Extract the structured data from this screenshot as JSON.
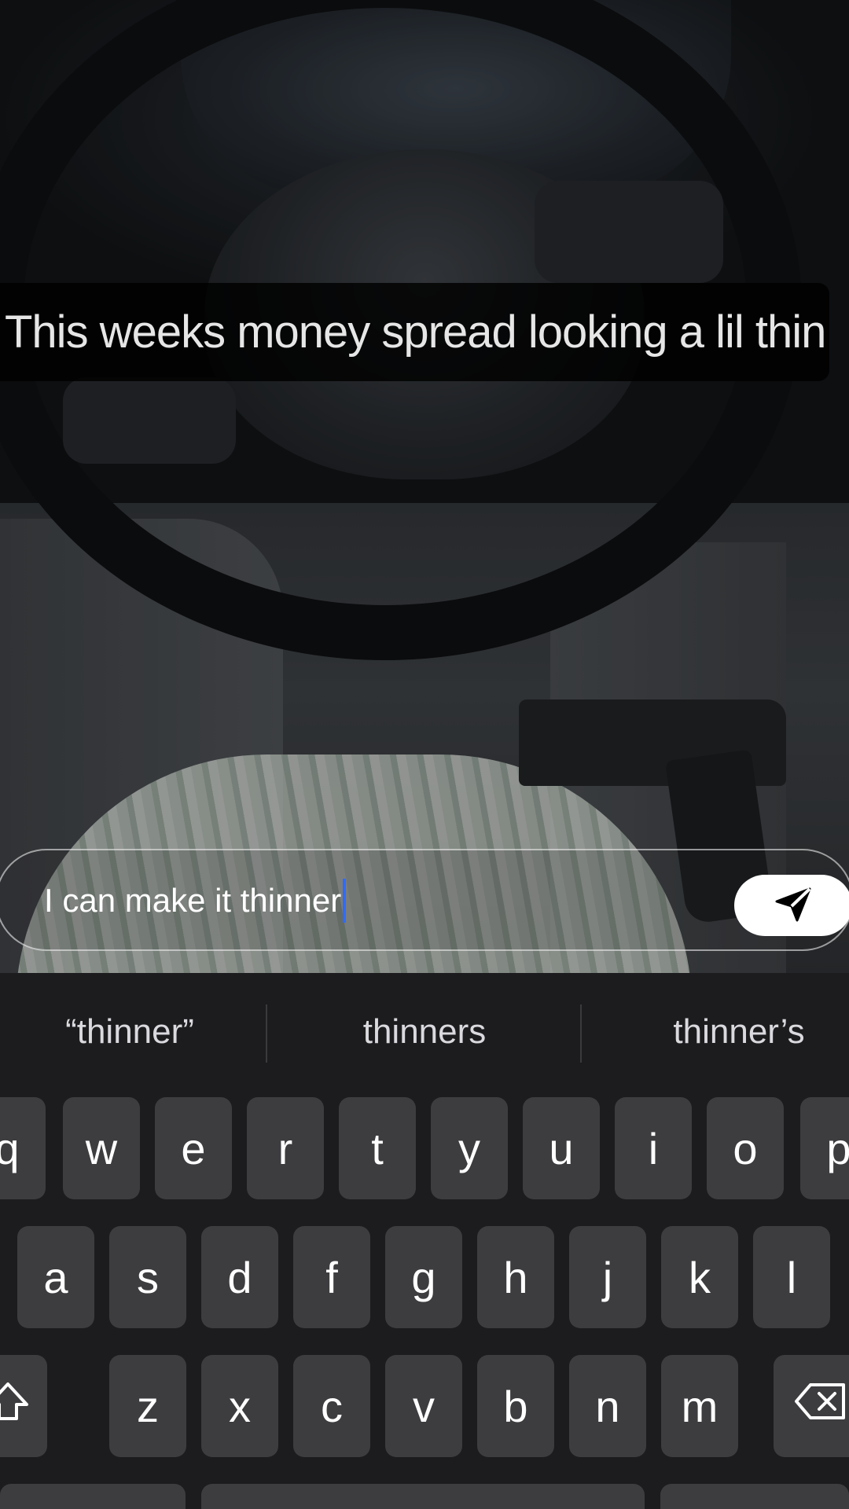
{
  "caption": {
    "text": "This weeks money spread looking a lil thin"
  },
  "reply": {
    "value": "I can make it thinner"
  },
  "send_button": {
    "icon": "paper-plane-icon"
  },
  "keyboard": {
    "suggestions": [
      "“thinner”",
      "thinners",
      "thinner’s"
    ],
    "row1": [
      "q",
      "w",
      "e",
      "r",
      "t",
      "y",
      "u",
      "i",
      "o",
      "p"
    ],
    "row2": [
      "a",
      "s",
      "d",
      "f",
      "g",
      "h",
      "j",
      "k",
      "l"
    ],
    "row3": [
      "z",
      "x",
      "c",
      "v",
      "b",
      "n",
      "m"
    ],
    "shift_icon": "shift-icon",
    "delete_icon": "backspace-icon"
  },
  "colors": {
    "keyboard_bg": "#1c1c1e",
    "key_bg": "#3d3d40",
    "caret": "#2f6bff",
    "send_button_bg": "#ffffff"
  }
}
